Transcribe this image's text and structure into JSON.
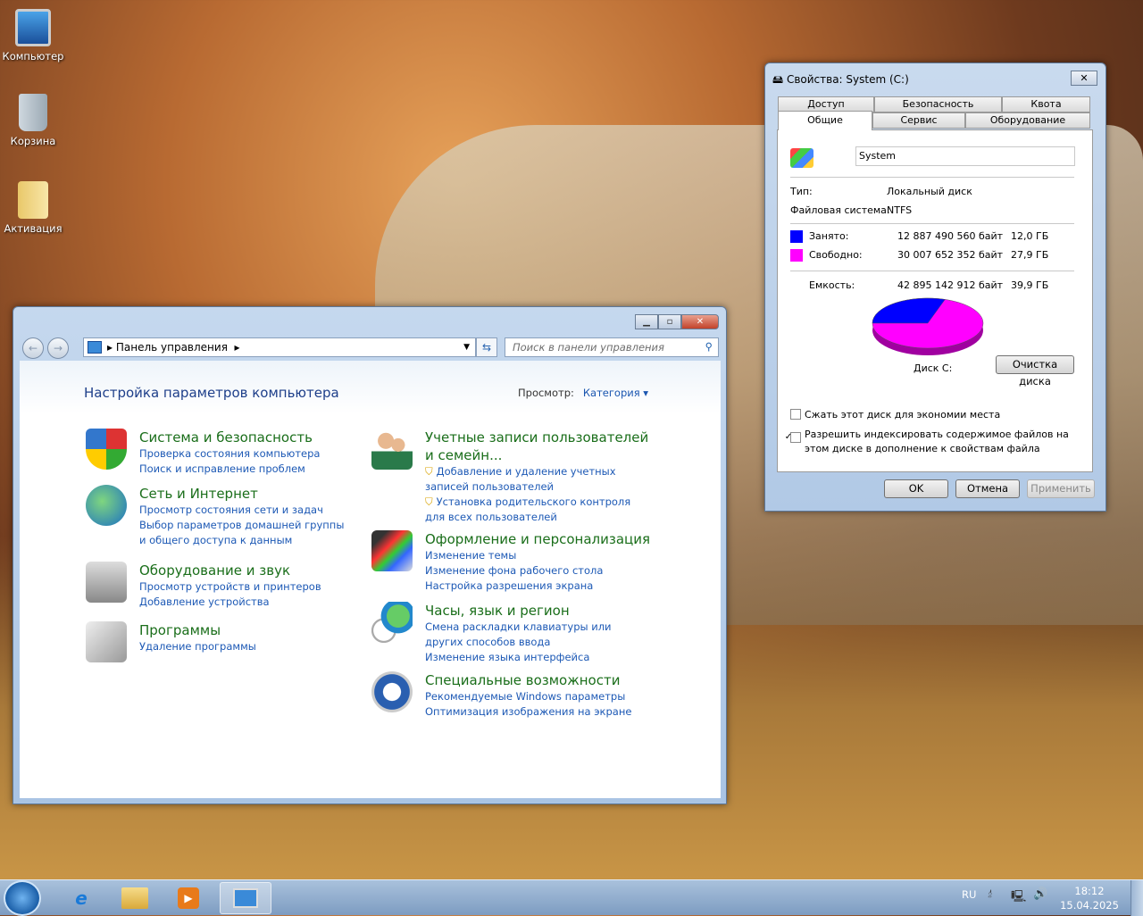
{
  "desktop": {
    "icons": [
      {
        "label": "Компьютер",
        "icon": "computer-icon"
      },
      {
        "label": "Корзина",
        "icon": "recycle-bin-icon"
      },
      {
        "label": "Активация",
        "icon": "folder-icon"
      }
    ]
  },
  "control_panel": {
    "address": "Панель управления",
    "search_placeholder": "Поиск в панели управления",
    "heading": "Настройка параметров компьютера",
    "view_label": "Просмотр:",
    "view_value": "Категория",
    "left": [
      {
        "title": "Система и безопасность",
        "links": [
          "Проверка состояния компьютера",
          "Поиск и исправление проблем"
        ]
      },
      {
        "title": "Сеть и Интернет",
        "links": [
          "Просмотр состояния сети и задач",
          "Выбор параметров домашней группы и общего доступа к данным"
        ]
      },
      {
        "title": "Оборудование и звук",
        "links": [
          "Просмотр устройств и принтеров",
          "Добавление устройства"
        ]
      },
      {
        "title": "Программы",
        "links": [
          "Удаление программы"
        ]
      }
    ],
    "right": [
      {
        "title": "Учетные записи пользователей и семейн...",
        "links": [
          "Добавление и удаление учетных записей пользователей",
          "Установка родительского контроля для всех пользователей"
        ]
      },
      {
        "title": "Оформление и персонализация",
        "links": [
          "Изменение темы",
          "Изменение фона рабочего стола",
          "Настройка разрешения экрана"
        ]
      },
      {
        "title": "Часы, язык и регион",
        "links": [
          "Смена раскладки клавиатуры или других способов ввода",
          "Изменение языка интерфейса"
        ]
      },
      {
        "title": "Специальные возможности",
        "links": [
          "Рекомендуемые Windows параметры",
          "Оптимизация изображения на экране"
        ]
      }
    ]
  },
  "properties": {
    "title": "Свойства: System (C:)",
    "tabs_back": [
      "Доступ",
      "Безопасность",
      "Квота"
    ],
    "tabs_front": [
      "Общие",
      "Сервис",
      "Оборудование"
    ],
    "volume_name": "System",
    "type_label": "Тип:",
    "type_value": "Локальный диск",
    "fs_label": "Файловая система:",
    "fs_value": "NTFS",
    "used_label": "Занято:",
    "used_bytes": "12 887 490 560 байт",
    "used_gb": "12,0 ГБ",
    "free_label": "Свободно:",
    "free_bytes": "30 007 652 352 байт",
    "free_gb": "27,9 ГБ",
    "cap_label": "Емкость:",
    "cap_bytes": "42 895 142 912 байт",
    "cap_gb": "39,9 ГБ",
    "disk_label": "Диск С:",
    "cleanup_button": "Очистка диска",
    "compress_label": "Сжать этот диск для экономии места",
    "compress_checked": false,
    "index_label": "Разрешить индексировать содержимое файлов на этом диске в дополнение к свойствам файла",
    "index_checked": true,
    "ok": "OK",
    "cancel": "Отмена",
    "apply": "Применить",
    "used_color": "#0000ff",
    "free_color": "#ff00ff",
    "used_fraction": 0.3004
  },
  "taskbar": {
    "lang": "RU",
    "time": "18:12",
    "date": "15.04.2025"
  }
}
